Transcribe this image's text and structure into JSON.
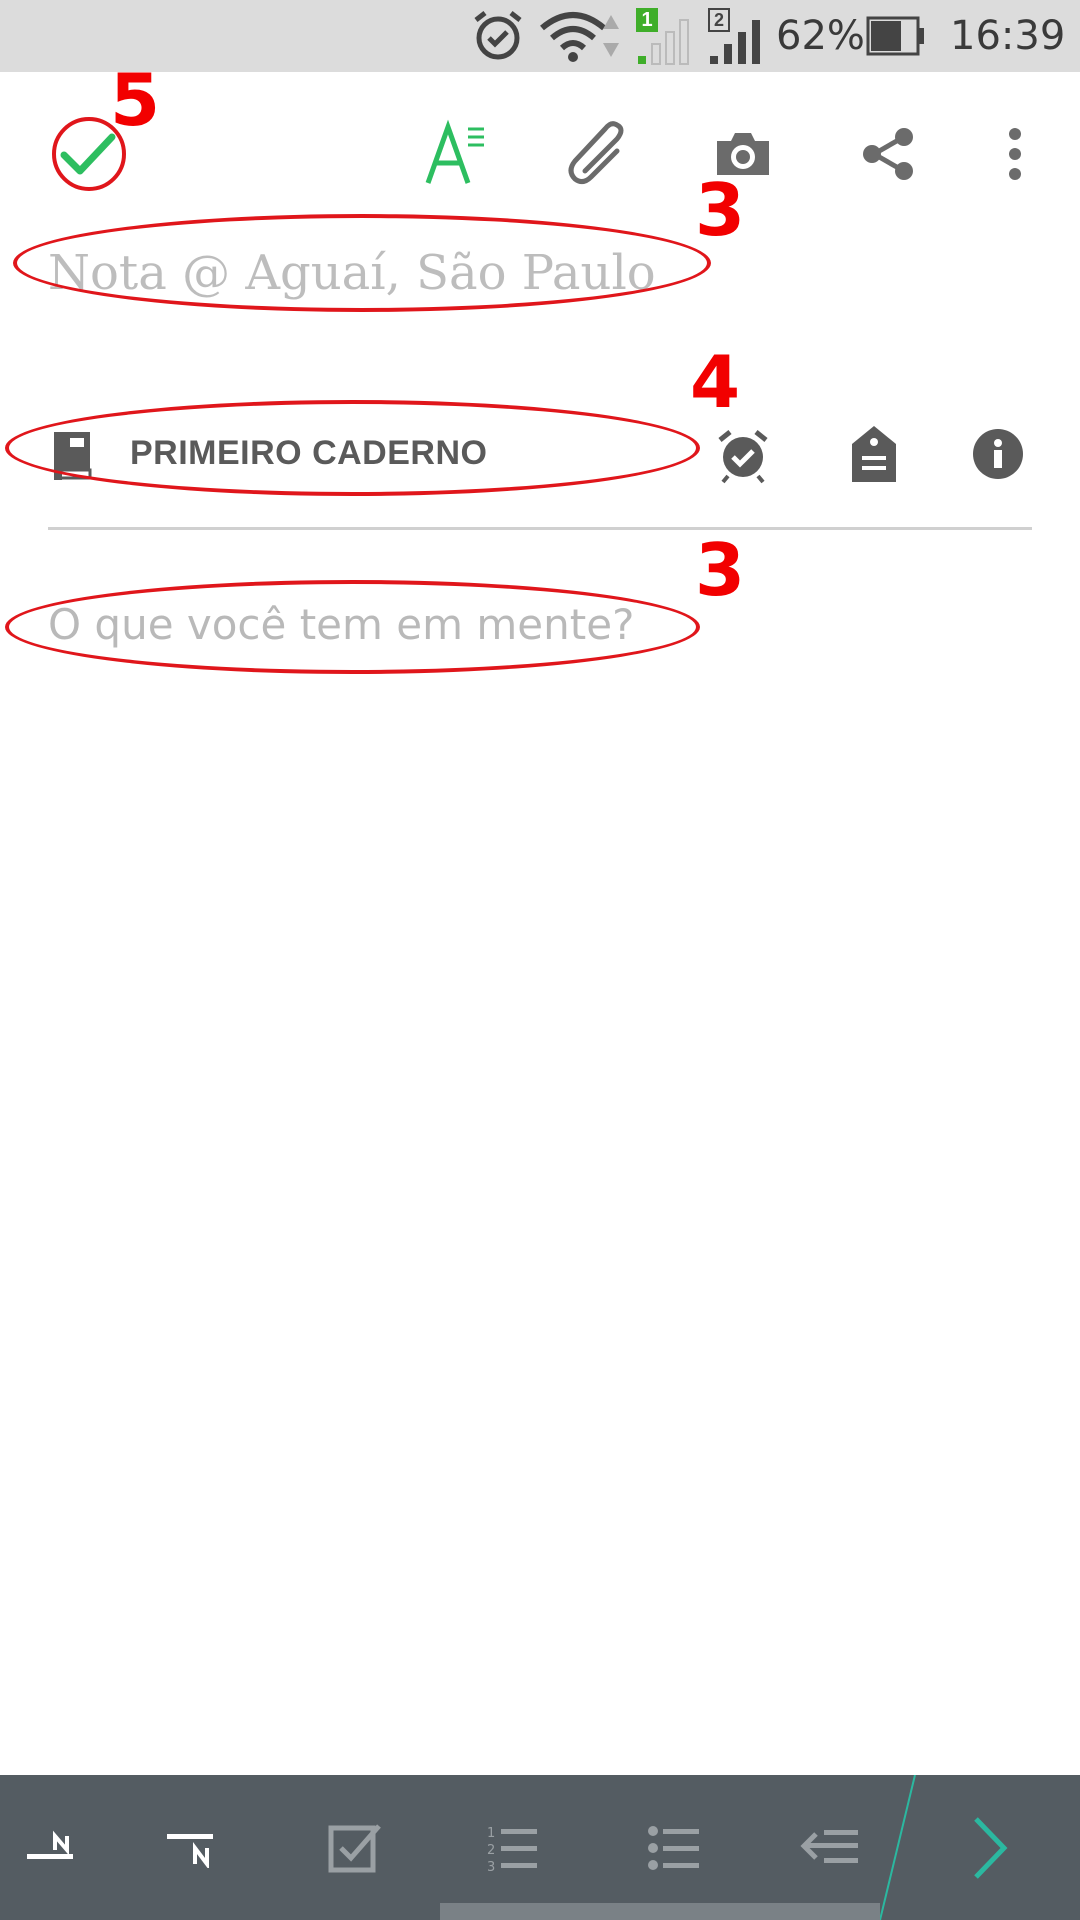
{
  "status_bar": {
    "battery_percent": "62%",
    "time": "16:39",
    "sim1": "1",
    "sim2": "2",
    "icons": [
      "alarm-icon",
      "wifi-icon",
      "signal-sim1-icon",
      "signal-sim2-icon",
      "battery-icon"
    ]
  },
  "toolbar": {
    "icons": [
      "done-check-icon",
      "text-format-icon",
      "attachment-icon",
      "camera-icon",
      "share-icon",
      "more-vert-icon"
    ],
    "accent_color": "#2dbe60"
  },
  "note": {
    "title_placeholder": "Nota @ Aguaí, São Paulo",
    "notebook": "PRIMEIRO CADERNO",
    "body_placeholder": "O que você tem em mente?"
  },
  "meta_icons": [
    "notebook-icon",
    "reminder-icon",
    "tag-icon",
    "info-icon"
  ],
  "annotations": {
    "done": "5",
    "title": "3",
    "notebook": "4",
    "body": "3",
    "color": "#e0161b"
  },
  "format_bar": {
    "icons": [
      "superscript-icon",
      "subscript-icon",
      "checkbox-icon",
      "numbered-list-icon",
      "bulleted-list-icon",
      "outdent-icon",
      "expand-next-icon"
    ]
  }
}
